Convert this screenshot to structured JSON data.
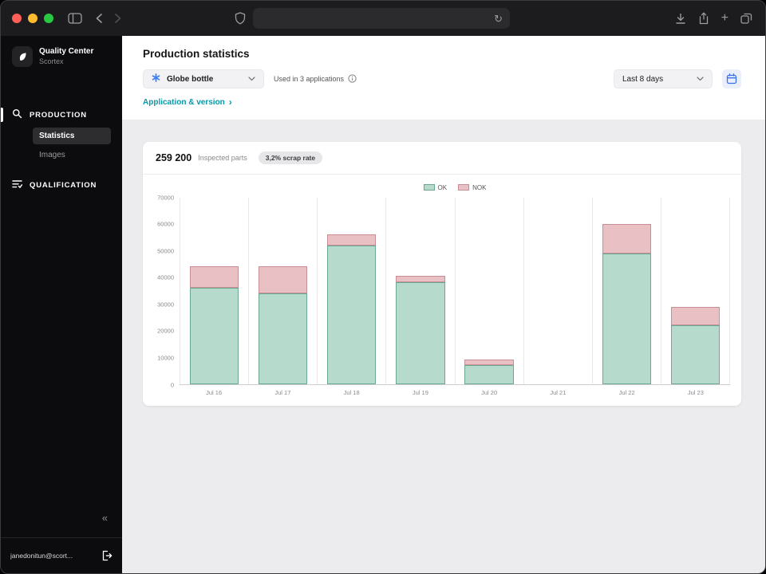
{
  "icons": {
    "reload": "↻",
    "new_tab": "+",
    "collapse_sidebar": "«",
    "chevron_right": "›"
  },
  "colors": {
    "accent_link": "#0899a8",
    "product_icon_blue": "#3b82f6"
  },
  "sidebar": {
    "app_name": "Quality Center",
    "app_subtitle": "Scortex",
    "sections": [
      {
        "label": "PRODUCTION",
        "items": [
          {
            "label": "Statistics",
            "active": true
          },
          {
            "label": "Images",
            "active": false
          }
        ]
      },
      {
        "label": "QUALIFICATION",
        "items": []
      }
    ],
    "account_email": "janedonitun@scort..."
  },
  "header": {
    "title": "Production statistics",
    "product_dropdown": "Globe bottle",
    "used_in": "Used in 3 applications",
    "app_version_link": "Application & version",
    "date_range": "Last 8 days"
  },
  "stats": {
    "inspected_value": "259 200",
    "inspected_label": "Inspected parts",
    "scrap_badge": "3,2% scrap rate"
  },
  "chart_data": {
    "type": "bar",
    "stacked": true,
    "title": "",
    "xlabel": "",
    "ylabel": "",
    "categories": [
      "Jul 16",
      "Jul 17",
      "Jul 18",
      "Jul 19",
      "Jul 20",
      "Jul 21",
      "Jul 22",
      "Jul 23"
    ],
    "series": [
      {
        "name": "OK",
        "color": "#b6dacc",
        "border": "#68a98f",
        "values": [
          36000,
          34000,
          52000,
          38000,
          7000,
          0,
          49000,
          22000
        ]
      },
      {
        "name": "NOK",
        "color": "#e9c0c4",
        "border": "#c98e95",
        "values": [
          8000,
          10000,
          4000,
          2500,
          2000,
          0,
          11000,
          7000
        ]
      }
    ],
    "ylim": [
      0,
      70000
    ],
    "yticks": [
      0,
      10000,
      20000,
      30000,
      40000,
      50000,
      60000,
      70000
    ],
    "grid": "vertical",
    "legend_position": "top"
  }
}
